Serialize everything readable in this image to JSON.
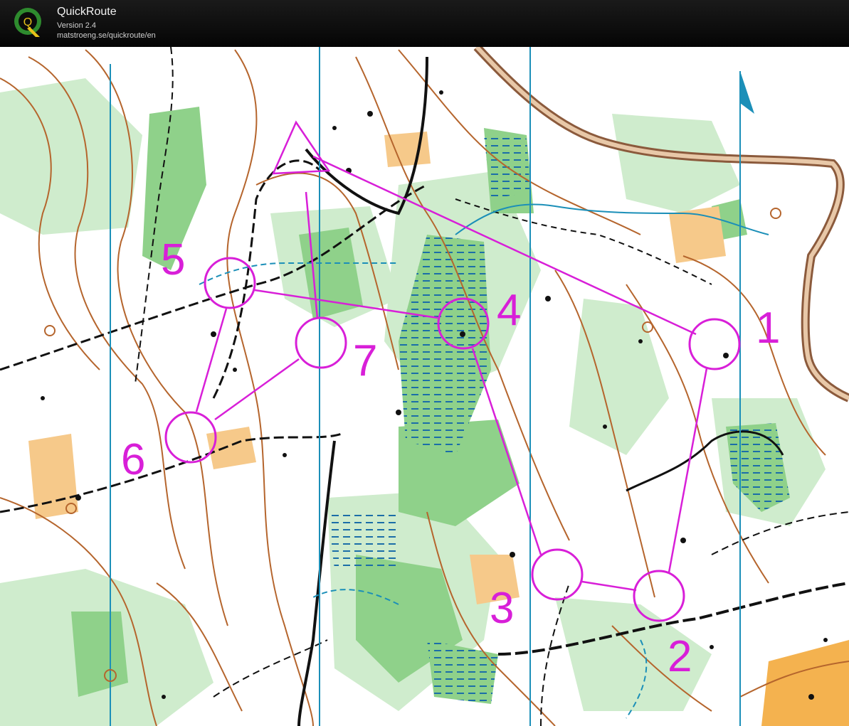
{
  "app": {
    "name": "QuickRoute",
    "version": "Version 2.4",
    "url": "matstroeng.se/quickroute/en",
    "logo_letter": "Q"
  },
  "map": {
    "course_color": "#d81fd8",
    "controls": [
      {
        "label": "1"
      },
      {
        "label": "2"
      },
      {
        "label": "3"
      },
      {
        "label": "4"
      },
      {
        "label": "5"
      },
      {
        "label": "6"
      },
      {
        "label": "7"
      }
    ],
    "icons": {
      "start": "start-triangle-icon",
      "north": "north-arrow-icon"
    }
  }
}
